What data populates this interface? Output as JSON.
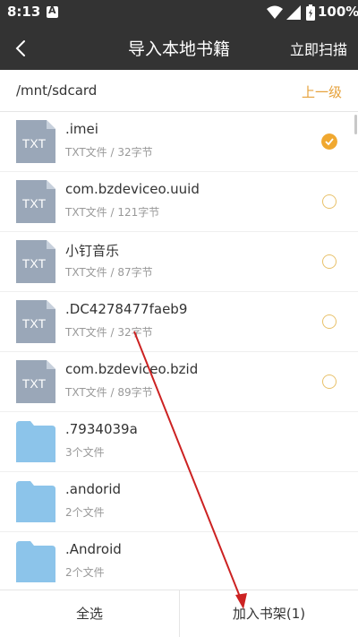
{
  "status_bar": {
    "time": "8:13",
    "notification_icon": "A",
    "battery_pct": "100%"
  },
  "header": {
    "title": "导入本地书籍",
    "scan_label": "立即扫描"
  },
  "path_bar": {
    "path": "/mnt/sdcard",
    "up_label": "上一级"
  },
  "files": [
    {
      "name": ".imei",
      "meta": "TXT文件 / 32字节",
      "type": "txt",
      "icon_text": "TXT",
      "selected": true
    },
    {
      "name": "com.bzdeviceo.uuid",
      "meta": "TXT文件 / 121字节",
      "type": "txt",
      "icon_text": "TXT",
      "selected": false
    },
    {
      "name": "小钉音乐",
      "meta": "TXT文件 / 87字节",
      "type": "txt",
      "icon_text": "TXT",
      "selected": false
    },
    {
      "name": ".DC4278477faeb9",
      "meta": "TXT文件 / 32字节",
      "type": "txt",
      "icon_text": "TXT",
      "selected": false
    },
    {
      "name": "com.bzdeviceo.bzid",
      "meta": "TXT文件 / 89字节",
      "type": "txt",
      "icon_text": "TXT",
      "selected": false
    },
    {
      "name": ".7934039a",
      "meta": "3个文件",
      "type": "folder"
    },
    {
      "name": ".andorid",
      "meta": "2个文件",
      "type": "folder"
    },
    {
      "name": ".Android",
      "meta": "2个文件",
      "type": "folder"
    }
  ],
  "bottom_bar": {
    "select_all_label": "全选",
    "add_label": "加入书架(1)"
  },
  "colors": {
    "header_bg": "#333333",
    "accent": "#f0a830",
    "file_icon": "#9aa7b8",
    "folder_icon": "#8cc4ea",
    "annotation": "#cc2222"
  }
}
